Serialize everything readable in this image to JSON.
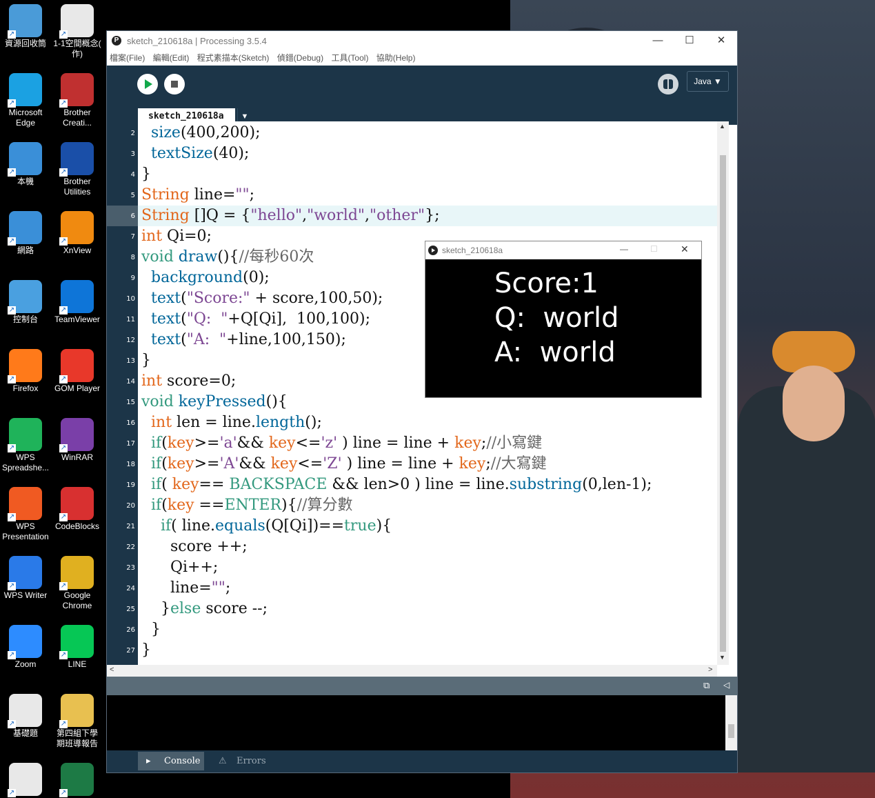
{
  "desktop": {
    "icons": [
      {
        "label": "資源回收筒",
        "icon": "recycle-bin-icon",
        "color": "#4a9bd8"
      },
      {
        "label": "1-1空間概念(\n作)",
        "icon": "document-icon",
        "color": "#e8e8e8"
      },
      {
        "label": "Microsoft\nEdge",
        "icon": "edge-icon",
        "color": "#1ba1e2"
      },
      {
        "label": "Brother\nCreati...",
        "icon": "brother-creative-icon",
        "color": "#c03030"
      },
      {
        "label": "本機",
        "icon": "computer-icon",
        "color": "#3a8fd8"
      },
      {
        "label": "Brother\nUtilities",
        "icon": "brother-utilities-icon",
        "color": "#1a4fa8"
      },
      {
        "label": "網路",
        "icon": "network-icon",
        "color": "#3a8fd8"
      },
      {
        "label": "XnView",
        "icon": "xnview-icon",
        "color": "#f08a10"
      },
      {
        "label": "控制台",
        "icon": "control-panel-icon",
        "color": "#4aa0e0"
      },
      {
        "label": "TeamViewer",
        "icon": "teamviewer-icon",
        "color": "#0e75d8"
      },
      {
        "label": "Firefox",
        "icon": "firefox-icon",
        "color": "#ff7a1a"
      },
      {
        "label": "GOM Player",
        "icon": "gom-player-icon",
        "color": "#e8382a"
      },
      {
        "label": "WPS\nSpreadshe...",
        "icon": "wps-spreadsheet-icon",
        "color": "#1fb35a"
      },
      {
        "label": "WinRAR",
        "icon": "winrar-icon",
        "color": "#7a3fa8"
      },
      {
        "label": "WPS\nPresentation",
        "icon": "wps-presentation-icon",
        "color": "#f05a22"
      },
      {
        "label": "CodeBlocks",
        "icon": "codeblocks-icon",
        "color": "#d83030"
      },
      {
        "label": "WPS Writer",
        "icon": "wps-writer-icon",
        "color": "#2a7ae8"
      },
      {
        "label": "Google\nChrome",
        "icon": "chrome-icon",
        "color": "#e0b020"
      },
      {
        "label": "Zoom",
        "icon": "zoom-icon",
        "color": "#2d8cff"
      },
      {
        "label": "LINE",
        "icon": "line-icon",
        "color": "#06c755"
      },
      {
        "label": "基礎題",
        "icon": "document-icon",
        "color": "#e8e8e8"
      },
      {
        "label": "第四組下學\n期班導報告",
        "icon": "folder-icon",
        "color": "#e8c050"
      },
      {
        "label": "",
        "icon": "presentation-file-icon",
        "color": "#e8e8e8"
      },
      {
        "label": "",
        "icon": "excel-file-icon",
        "color": "#1d7a45"
      }
    ]
  },
  "ide": {
    "title": "sketch_210618a | Processing 3.5.4",
    "menu": [
      "檔案(File)",
      "編輯(Edit)",
      "程式素描本(Sketch)",
      "偵錯(Debug)",
      "工具(Tool)",
      "協助(Help)"
    ],
    "mode": "Java ▼",
    "tab": "sketch_210618a",
    "tab_arrow": "▼",
    "line_numbers": [
      "2",
      "3",
      "4",
      "5",
      "6",
      "7",
      "8",
      "9",
      "10",
      "11",
      "12",
      "13",
      "14",
      "15",
      "16",
      "17",
      "18",
      "19",
      "20",
      "21",
      "22",
      "23",
      "24",
      "25",
      "26",
      "27"
    ],
    "code": [
      [
        {
          "t": "  "
        },
        {
          "t": "size",
          "c": "k3"
        },
        {
          "t": "(400,200);"
        }
      ],
      [
        {
          "t": "  "
        },
        {
          "t": "textSize",
          "c": "k3"
        },
        {
          "t": "(40);"
        }
      ],
      [
        {
          "t": "}"
        }
      ],
      [
        {
          "t": "String",
          "c": "k1"
        },
        {
          "t": " line="
        },
        {
          "t": "\"\"",
          "c": "st"
        },
        {
          "t": ";"
        }
      ],
      [
        {
          "t": "String",
          "c": "k1"
        },
        {
          "t": " []Q = {"
        },
        {
          "t": "\"hello\"",
          "c": "st"
        },
        {
          "t": ","
        },
        {
          "t": "\"world\"",
          "c": "st"
        },
        {
          "t": ","
        },
        {
          "t": "\"other\"",
          "c": "st"
        },
        {
          "t": "};"
        }
      ],
      [
        {
          "t": "int",
          "c": "k1"
        },
        {
          "t": " Qi=0;"
        }
      ],
      [
        {
          "t": "void",
          "c": "k2"
        },
        {
          "t": " "
        },
        {
          "t": "draw",
          "c": "k3"
        },
        {
          "t": "(){"
        },
        {
          "t": "//每秒60次",
          "c": "cm"
        }
      ],
      [
        {
          "t": "  "
        },
        {
          "t": "background",
          "c": "k3"
        },
        {
          "t": "(0);"
        }
      ],
      [
        {
          "t": "  "
        },
        {
          "t": "text",
          "c": "k3"
        },
        {
          "t": "("
        },
        {
          "t": "\"Score:\"",
          "c": "st"
        },
        {
          "t": " + score,100,50);"
        }
      ],
      [
        {
          "t": "  "
        },
        {
          "t": "text",
          "c": "k3"
        },
        {
          "t": "("
        },
        {
          "t": "\"Q:  \"",
          "c": "st"
        },
        {
          "t": "+Q[Qi],  100,100);"
        }
      ],
      [
        {
          "t": "  "
        },
        {
          "t": "text",
          "c": "k3"
        },
        {
          "t": "("
        },
        {
          "t": "\"A:  \"",
          "c": "st"
        },
        {
          "t": "+line,100,150);"
        }
      ],
      [
        {
          "t": "}"
        }
      ],
      [
        {
          "t": "int",
          "c": "k1"
        },
        {
          "t": " score=0;"
        }
      ],
      [
        {
          "t": "void",
          "c": "k2"
        },
        {
          "t": " "
        },
        {
          "t": "keyPressed",
          "c": "k3"
        },
        {
          "t": "(){"
        }
      ],
      [
        {
          "t": "  "
        },
        {
          "t": "int",
          "c": "k1"
        },
        {
          "t": " len = line."
        },
        {
          "t": "length",
          "c": "k3"
        },
        {
          "t": "();"
        }
      ],
      [
        {
          "t": "  "
        },
        {
          "t": "if",
          "c": "k2"
        },
        {
          "t": "("
        },
        {
          "t": "key",
          "c": "k1"
        },
        {
          "t": ">="
        },
        {
          "t": "'a'",
          "c": "st"
        },
        {
          "t": "&& "
        },
        {
          "t": "key",
          "c": "k1"
        },
        {
          "t": "<="
        },
        {
          "t": "'z'",
          "c": "st"
        },
        {
          "t": " ) line = line + "
        },
        {
          "t": "key",
          "c": "k1"
        },
        {
          "t": ";"
        },
        {
          "t": "//小寫鍵",
          "c": "cm"
        }
      ],
      [
        {
          "t": "  "
        },
        {
          "t": "if",
          "c": "k2"
        },
        {
          "t": "("
        },
        {
          "t": "key",
          "c": "k1"
        },
        {
          "t": ">="
        },
        {
          "t": "'A'",
          "c": "st"
        },
        {
          "t": "&& "
        },
        {
          "t": "key",
          "c": "k1"
        },
        {
          "t": "<="
        },
        {
          "t": "'Z'",
          "c": "st"
        },
        {
          "t": " ) line = line + "
        },
        {
          "t": "key",
          "c": "k1"
        },
        {
          "t": ";"
        },
        {
          "t": "//大寫鍵",
          "c": "cm"
        }
      ],
      [
        {
          "t": "  "
        },
        {
          "t": "if",
          "c": "k2"
        },
        {
          "t": "( "
        },
        {
          "t": "key",
          "c": "k1"
        },
        {
          "t": "== "
        },
        {
          "t": "BACKSPACE",
          "c": "k2"
        },
        {
          "t": " && len>0 ) line = line."
        },
        {
          "t": "substring",
          "c": "k3"
        },
        {
          "t": "(0,len-1);"
        }
      ],
      [
        {
          "t": "  "
        },
        {
          "t": "if",
          "c": "k2"
        },
        {
          "t": "("
        },
        {
          "t": "key",
          "c": "k1"
        },
        {
          "t": " =="
        },
        {
          "t": "ENTER",
          "c": "k2"
        },
        {
          "t": "){"
        },
        {
          "t": "//算分數",
          "c": "cm"
        }
      ],
      [
        {
          "t": "    "
        },
        {
          "t": "if",
          "c": "k2"
        },
        {
          "t": "( line."
        },
        {
          "t": "equals",
          "c": "k3"
        },
        {
          "t": "(Q[Qi])=="
        },
        {
          "t": "true",
          "c": "k2"
        },
        {
          "t": "){"
        }
      ],
      [
        {
          "t": "      score ++;"
        }
      ],
      [
        {
          "t": "      Qi++;"
        }
      ],
      [
        {
          "t": "      line="
        },
        {
          "t": "\"\"",
          "c": "st"
        },
        {
          "t": ";"
        }
      ],
      [
        {
          "t": "    }"
        },
        {
          "t": "else",
          "c": "k2"
        },
        {
          "t": " score --;"
        }
      ],
      [
        {
          "t": "  }"
        }
      ],
      [
        {
          "t": "}"
        }
      ]
    ],
    "highlight_line": "6",
    "footer": {
      "console": "Console",
      "errors": "Errors"
    }
  },
  "sketch": {
    "title": "sketch_210618a",
    "output": [
      "Score:1",
      "Q:  world",
      "A:  world"
    ]
  },
  "colors": {
    "ide_dark": "#1c3548",
    "keyword_orange": "#e2661a",
    "keyword_green": "#33997e",
    "function_blue": "#006699",
    "string_purple": "#7d4793"
  }
}
